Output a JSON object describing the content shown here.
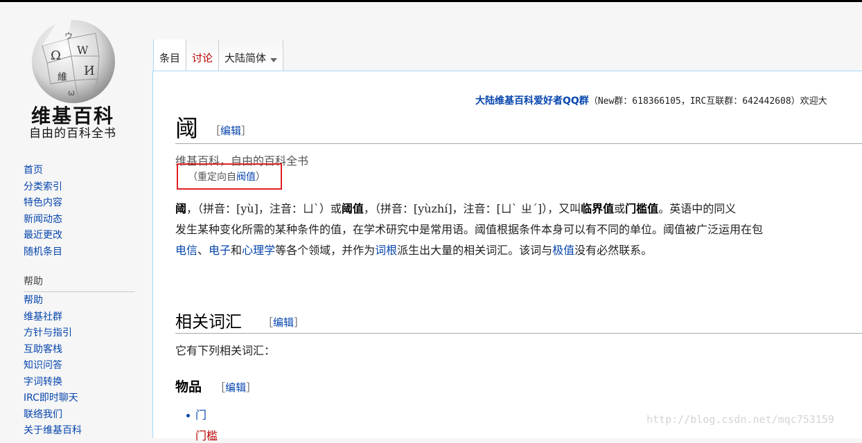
{
  "logo": {
    "title": "维基百科",
    "subtitle": "自由的百科全书"
  },
  "nav": {
    "items": [
      "首页",
      "分类索引",
      "特色内容",
      "新闻动态",
      "最近更改",
      "随机条目"
    ],
    "help_heading": "帮助",
    "help_items": [
      "帮助",
      "维基社群",
      "方针与指引",
      "互助客栈",
      "知识问答",
      "字词转换",
      "IRC即时聊天",
      "联络我们",
      "关于维基百科"
    ]
  },
  "tabs": {
    "article": "条目",
    "talk": "讨论",
    "variant": "大陆简体"
  },
  "sitenotice": {
    "qq": "大陆维基百科爱好者QQ群",
    "rest": "（New群：618366105，IRC互联群：642442608）欢迎大"
  },
  "article": {
    "title": "阈",
    "edit_open": "［",
    "edit_label": "编辑",
    "edit_close": "］",
    "tagline": "维基百科，自由的百科全书",
    "redirect_prefix": "（重定向自",
    "redirect_link": "阀值",
    "redirect_suffix": "）",
    "p1": {
      "b1": "阈",
      "t1": "，（拼音：[yù]，注音：ㄩˋ）或",
      "b2": "阈值",
      "t2": "，（拼音：[yùzhí]，注音：[ㄩˋ ㄓˊ]），又叫",
      "b3": "临界值",
      "t3": "或",
      "b4": "门槛值",
      "t4": "。英语中的同义"
    },
    "p2": "发生某种变化所需的某种条件的值，在学术研究中是常用语。阈值根据条件本身可以有不同的单位。阈值被广泛运用在包",
    "p3": {
      "l1": "电信",
      "t1": "、",
      "l2": "电子",
      "t2": "和",
      "l3": "心理学",
      "t3": "等各个领域，并作为",
      "l4": "词根",
      "t4": "派生出大量的相关词汇。该词与",
      "l5": "极值",
      "t5": "没有必然联系。"
    },
    "section_title": "相关词汇",
    "section_intro": "它有下列相关词汇：",
    "subsection_title": "物品",
    "list": [
      "门",
      "门槛"
    ]
  },
  "watermark": "http://blog.csdn.net/mqc753159",
  "colors": {
    "link": "#0645ad",
    "new_link": "#ba0000",
    "highlight_box": "#e02020"
  }
}
